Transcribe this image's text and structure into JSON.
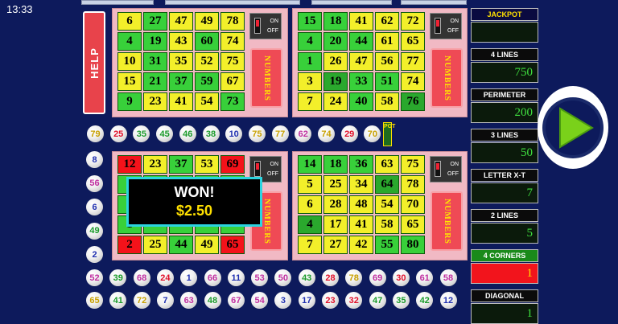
{
  "status_bar": {
    "time": "13:33"
  },
  "help_label": "HELP",
  "numbers_label": "NUMBERS",
  "toggle": {
    "on": "ON",
    "off": "OFF"
  },
  "pot_label": "POT",
  "won": {
    "title": "WON!",
    "amount": "$2.50"
  },
  "cards": [
    {
      "id": "card-1",
      "toggle_on": false,
      "rows": [
        [
          {
            "n": "6",
            "c": "y"
          },
          {
            "n": "27",
            "c": "g"
          },
          {
            "n": "47",
            "c": "y"
          },
          {
            "n": "49",
            "c": "y"
          },
          {
            "n": "78",
            "c": "y"
          }
        ],
        [
          {
            "n": "4",
            "c": "g"
          },
          {
            "n": "19",
            "c": "g"
          },
          {
            "n": "43",
            "c": "y"
          },
          {
            "n": "60",
            "c": "g"
          },
          {
            "n": "74",
            "c": "y"
          }
        ],
        [
          {
            "n": "10",
            "c": "y"
          },
          {
            "n": "31",
            "c": "g"
          },
          {
            "n": "35",
            "c": "y"
          },
          {
            "n": "52",
            "c": "y"
          },
          {
            "n": "75",
            "c": "y"
          }
        ],
        [
          {
            "n": "15",
            "c": "y"
          },
          {
            "n": "21",
            "c": "g"
          },
          {
            "n": "37",
            "c": "g"
          },
          {
            "n": "59",
            "c": "g"
          },
          {
            "n": "67",
            "c": "y"
          }
        ],
        [
          {
            "n": "9",
            "c": "g"
          },
          {
            "n": "23",
            "c": "y"
          },
          {
            "n": "41",
            "c": "y"
          },
          {
            "n": "54",
            "c": "y"
          },
          {
            "n": "73",
            "c": "g"
          }
        ]
      ]
    },
    {
      "id": "card-2",
      "toggle_on": false,
      "rows": [
        [
          {
            "n": "15",
            "c": "g"
          },
          {
            "n": "18",
            "c": "g"
          },
          {
            "n": "41",
            "c": "y"
          },
          {
            "n": "62",
            "c": "y"
          },
          {
            "n": "72",
            "c": "y"
          }
        ],
        [
          {
            "n": "4",
            "c": "g"
          },
          {
            "n": "20",
            "c": "g"
          },
          {
            "n": "44",
            "c": "g"
          },
          {
            "n": "61",
            "c": "y"
          },
          {
            "n": "65",
            "c": "y"
          }
        ],
        [
          {
            "n": "1",
            "c": "g"
          },
          {
            "n": "26",
            "c": "y"
          },
          {
            "n": "47",
            "c": "y"
          },
          {
            "n": "56",
            "c": "y"
          },
          {
            "n": "77",
            "c": "y"
          }
        ],
        [
          {
            "n": "3",
            "c": "y"
          },
          {
            "n": "19",
            "c": "g2"
          },
          {
            "n": "33",
            "c": "g"
          },
          {
            "n": "51",
            "c": "g"
          },
          {
            "n": "74",
            "c": "y"
          }
        ],
        [
          {
            "n": "7",
            "c": "y"
          },
          {
            "n": "24",
            "c": "y"
          },
          {
            "n": "40",
            "c": "g"
          },
          {
            "n": "58",
            "c": "y"
          },
          {
            "n": "76",
            "c": "g2"
          }
        ]
      ]
    },
    {
      "id": "card-3",
      "toggle_on": false,
      "rows": [
        [
          {
            "n": "12",
            "c": "r"
          },
          {
            "n": "23",
            "c": "y"
          },
          {
            "n": "37",
            "c": "g"
          },
          {
            "n": "53",
            "c": "y"
          },
          {
            "n": "69",
            "c": "r"
          }
        ],
        [
          {
            "n": "",
            "c": "g"
          },
          {
            "n": "",
            "c": "g"
          },
          {
            "n": "",
            "c": "g"
          },
          {
            "n": "",
            "c": "g"
          },
          {
            "n": "",
            "c": "g"
          }
        ],
        [
          {
            "n": "",
            "c": "g"
          },
          {
            "n": "",
            "c": "g"
          },
          {
            "n": "",
            "c": "g"
          },
          {
            "n": "",
            "c": "g"
          },
          {
            "n": "",
            "c": "g"
          }
        ],
        [
          {
            "n": "1",
            "c": "g"
          },
          {
            "n": "",
            "c": "g"
          },
          {
            "n": "",
            "c": "g"
          },
          {
            "n": "",
            "c": "g"
          },
          {
            "n": "",
            "c": "g"
          }
        ],
        [
          {
            "n": "2",
            "c": "r"
          },
          {
            "n": "25",
            "c": "y"
          },
          {
            "n": "44",
            "c": "g"
          },
          {
            "n": "49",
            "c": "y"
          },
          {
            "n": "65",
            "c": "r"
          }
        ]
      ]
    },
    {
      "id": "card-4",
      "toggle_on": false,
      "rows": [
        [
          {
            "n": "14",
            "c": "g"
          },
          {
            "n": "18",
            "c": "g"
          },
          {
            "n": "36",
            "c": "g"
          },
          {
            "n": "63",
            "c": "y"
          },
          {
            "n": "75",
            "c": "y"
          }
        ],
        [
          {
            "n": "5",
            "c": "y"
          },
          {
            "n": "25",
            "c": "y"
          },
          {
            "n": "34",
            "c": "y"
          },
          {
            "n": "64",
            "c": "g2"
          },
          {
            "n": "78",
            "c": "y"
          }
        ],
        [
          {
            "n": "6",
            "c": "y"
          },
          {
            "n": "28",
            "c": "y"
          },
          {
            "n": "48",
            "c": "y"
          },
          {
            "n": "54",
            "c": "y"
          },
          {
            "n": "70",
            "c": "y"
          }
        ],
        [
          {
            "n": "4",
            "c": "g2"
          },
          {
            "n": "17",
            "c": "y"
          },
          {
            "n": "41",
            "c": "y"
          },
          {
            "n": "58",
            "c": "y"
          },
          {
            "n": "65",
            "c": "y"
          }
        ],
        [
          {
            "n": "7",
            "c": "y"
          },
          {
            "n": "27",
            "c": "y"
          },
          {
            "n": "42",
            "c": "y"
          },
          {
            "n": "55",
            "c": "g"
          },
          {
            "n": "80",
            "c": "g"
          }
        ]
      ]
    }
  ],
  "drawn_balls_mid": [
    {
      "n": "79",
      "c": "#c8a000"
    },
    {
      "n": "25",
      "c": "#e0102a"
    },
    {
      "n": "35",
      "c": "#1a9a2a"
    },
    {
      "n": "45",
      "c": "#1a9a2a"
    },
    {
      "n": "46",
      "c": "#1a9a2a"
    },
    {
      "n": "38",
      "c": "#1a9a2a"
    },
    {
      "n": "10",
      "c": "#2030b0"
    },
    {
      "n": "75",
      "c": "#c8a000"
    },
    {
      "n": "77",
      "c": "#c8a000"
    },
    {
      "n": "62",
      "c": "#c030a0"
    },
    {
      "n": "74",
      "c": "#c8a000"
    },
    {
      "n": "29",
      "c": "#e0102a"
    },
    {
      "n": "70",
      "c": "#c8a000"
    }
  ],
  "drawn_balls_left": [
    {
      "n": "8",
      "c": "#2030b0"
    },
    {
      "n": "56",
      "c": "#c030a0"
    },
    {
      "n": "6",
      "c": "#2030b0"
    },
    {
      "n": "49",
      "c": "#1a9a2a"
    },
    {
      "n": "2",
      "c": "#2030b0"
    }
  ],
  "drawn_balls_row1": [
    {
      "n": "52",
      "c": "#c030a0"
    },
    {
      "n": "39",
      "c": "#1a9a2a"
    },
    {
      "n": "68",
      "c": "#c030a0"
    },
    {
      "n": "24",
      "c": "#e0102a"
    },
    {
      "n": "1",
      "c": "#2030b0"
    },
    {
      "n": "66",
      "c": "#c030a0"
    },
    {
      "n": "11",
      "c": "#2030b0"
    },
    {
      "n": "53",
      "c": "#c030a0"
    },
    {
      "n": "50",
      "c": "#c030a0"
    },
    {
      "n": "43",
      "c": "#1a9a2a"
    },
    {
      "n": "28",
      "c": "#e0102a"
    },
    {
      "n": "78",
      "c": "#c8a000"
    },
    {
      "n": "69",
      "c": "#c030a0"
    },
    {
      "n": "30",
      "c": "#e0102a"
    },
    {
      "n": "61",
      "c": "#c030a0"
    },
    {
      "n": "58",
      "c": "#c030a0"
    }
  ],
  "drawn_balls_row2": [
    {
      "n": "65",
      "c": "#c8a000"
    },
    {
      "n": "41",
      "c": "#1a9a2a"
    },
    {
      "n": "72",
      "c": "#c8a000"
    },
    {
      "n": "7",
      "c": "#2030b0"
    },
    {
      "n": "63",
      "c": "#c030a0"
    },
    {
      "n": "48",
      "c": "#1a9a2a"
    },
    {
      "n": "67",
      "c": "#c030a0"
    },
    {
      "n": "54",
      "c": "#c030a0"
    },
    {
      "n": "3",
      "c": "#2030b0"
    },
    {
      "n": "17",
      "c": "#2030b0"
    },
    {
      "n": "23",
      "c": "#e0102a"
    },
    {
      "n": "32",
      "c": "#e0102a"
    },
    {
      "n": "47",
      "c": "#1a9a2a"
    },
    {
      "n": "35",
      "c": "#1a9a2a"
    },
    {
      "n": "42",
      "c": "#1a9a2a"
    },
    {
      "n": "12",
      "c": "#2030b0"
    }
  ],
  "prize_panel": [
    {
      "label": "JACKPOT",
      "value": "",
      "highlight": "jackpot"
    },
    {
      "label": "4 LINES",
      "value": "750"
    },
    {
      "label": "PERIMETER",
      "value": "200"
    },
    {
      "label": "3 LINES",
      "value": "50"
    },
    {
      "label": "LETTER X-T",
      "value": "7"
    },
    {
      "label": "2 LINES",
      "value": "5"
    },
    {
      "label": "4 CORNERS",
      "value": "1",
      "highlight": "win"
    },
    {
      "label": "DIAGONAL",
      "value": "1"
    }
  ]
}
